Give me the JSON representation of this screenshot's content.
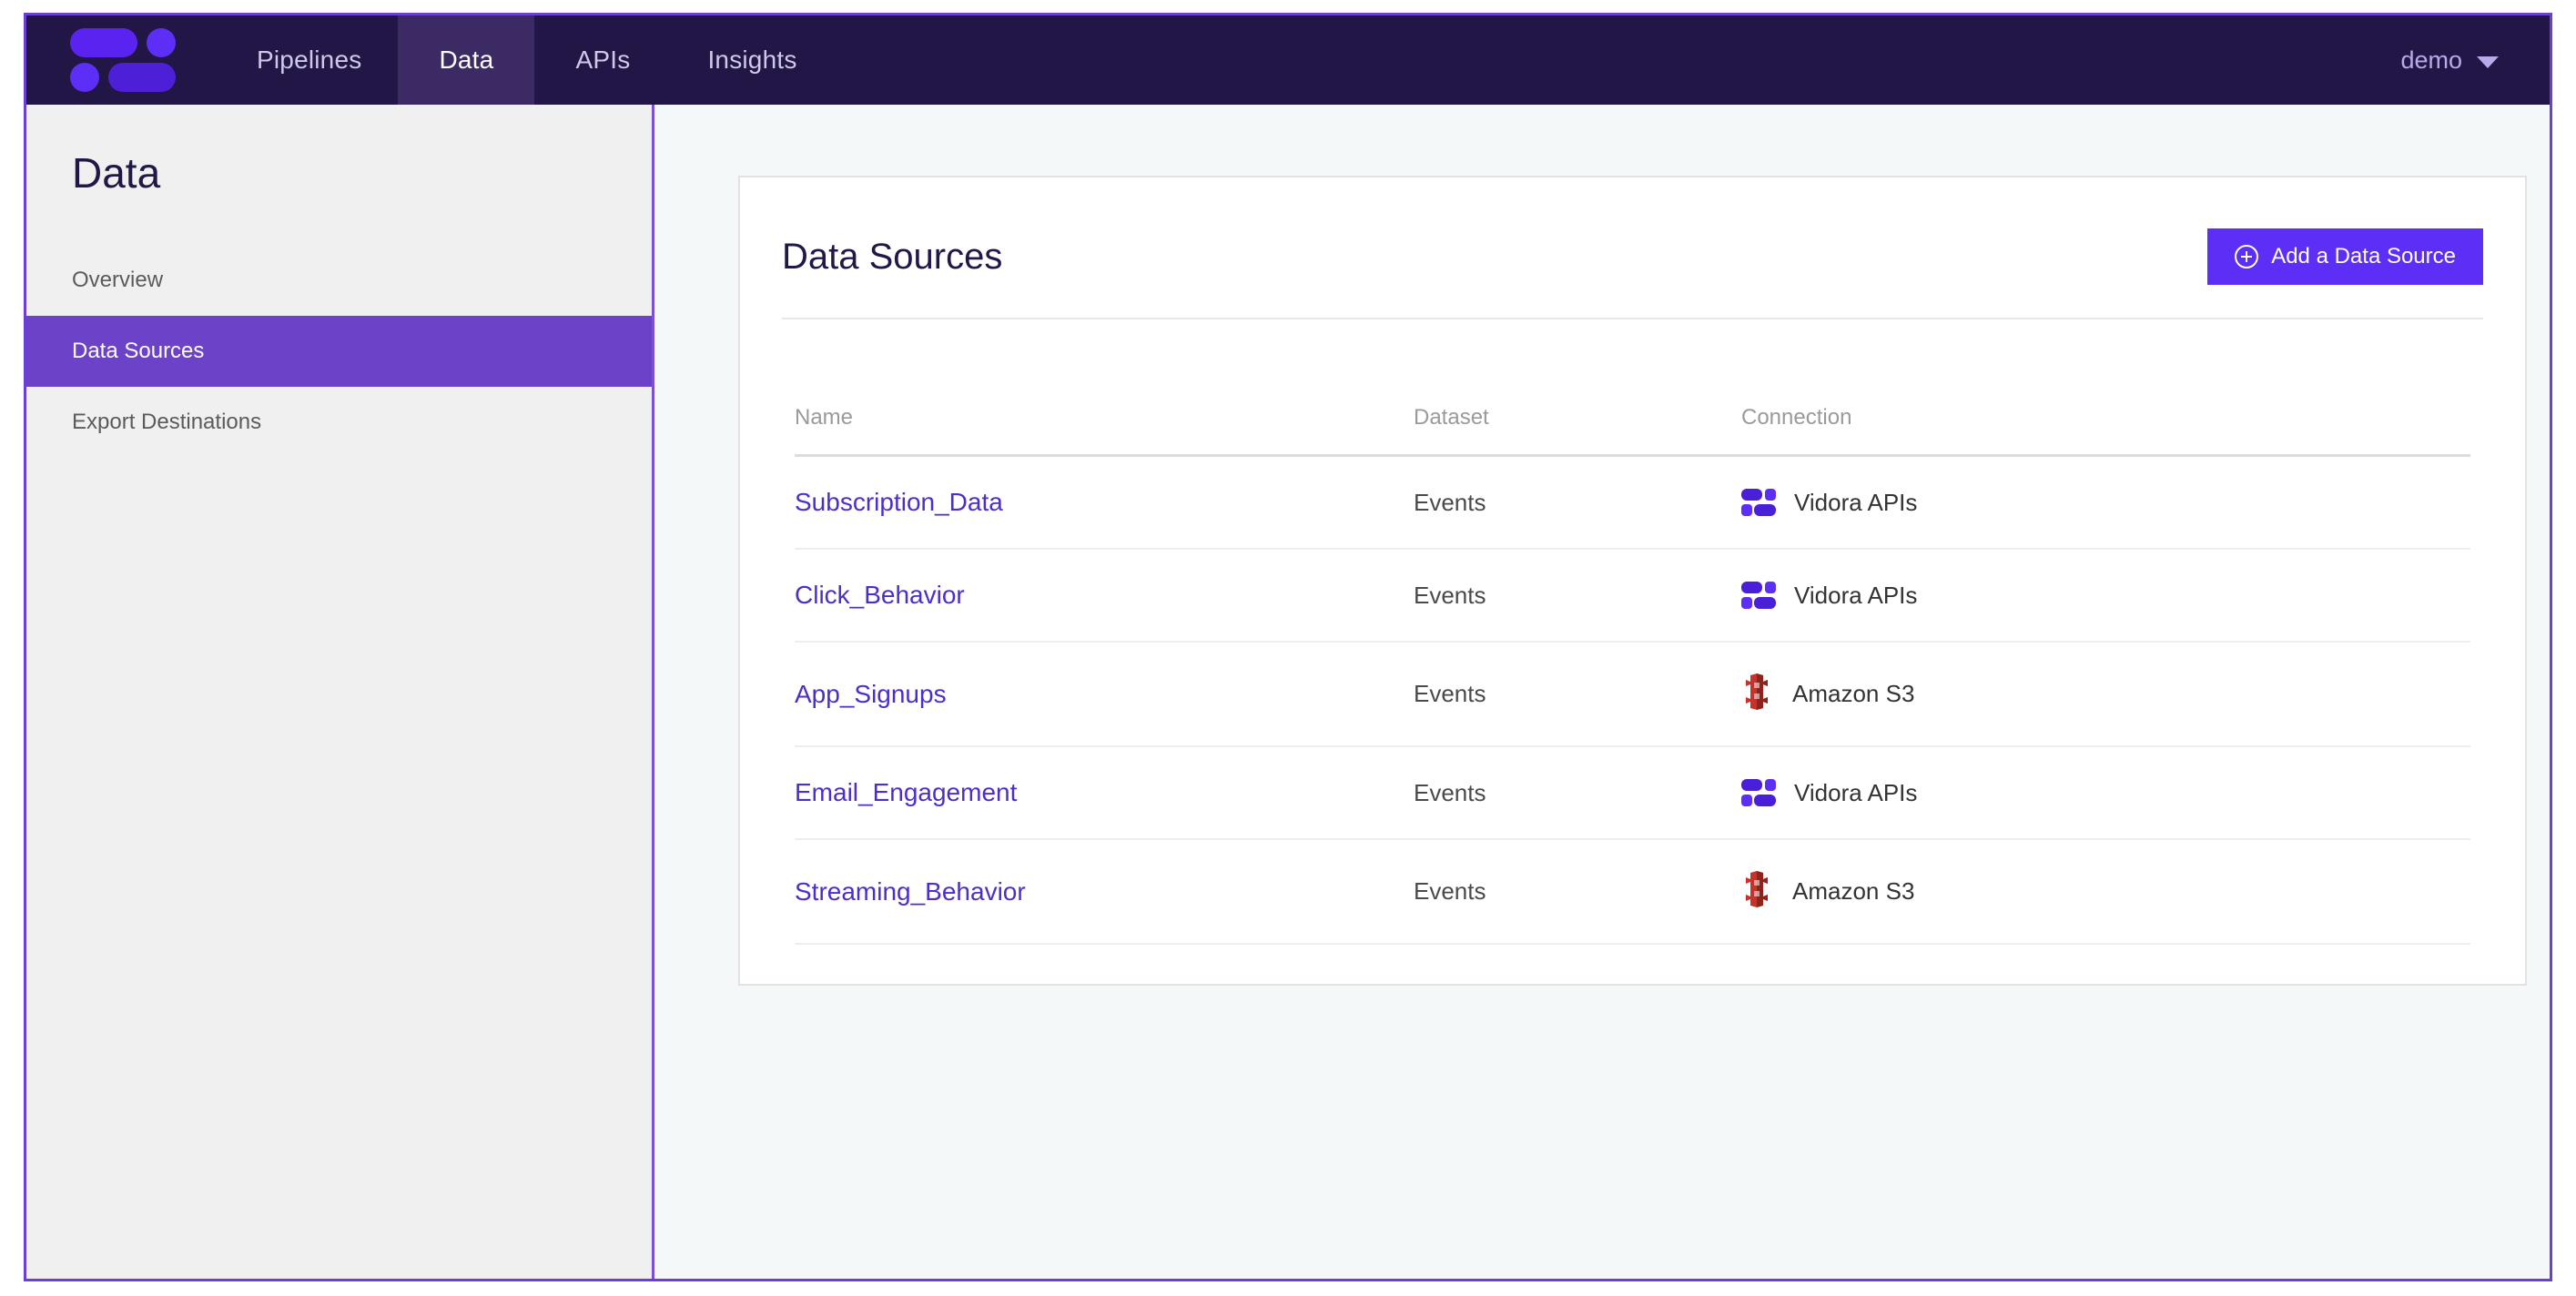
{
  "navbar": {
    "logo_name": "vidora-logo",
    "tabs": [
      {
        "label": "Pipelines",
        "active": false
      },
      {
        "label": "Data",
        "active": true
      },
      {
        "label": "APIs",
        "active": false
      },
      {
        "label": "Insights",
        "active": false
      }
    ],
    "account": {
      "label": "demo",
      "caret_icon": "chevron-down-icon"
    }
  },
  "sidebar": {
    "title": "Data",
    "items": [
      {
        "label": "Overview",
        "active": false
      },
      {
        "label": "Data Sources",
        "active": true
      },
      {
        "label": "Export Destinations",
        "active": false
      }
    ]
  },
  "card": {
    "title": "Data Sources",
    "add_button": {
      "label": "Add a Data Source",
      "icon": "plus-circle-icon"
    },
    "table": {
      "columns": [
        "Name",
        "Dataset",
        "Connection"
      ],
      "rows": [
        {
          "name": "Subscription_Data",
          "dataset": "Events",
          "connection": "Vidora APIs",
          "connection_icon": "vidora-icon"
        },
        {
          "name": "Click_Behavior",
          "dataset": "Events",
          "connection": "Vidora APIs",
          "connection_icon": "vidora-icon"
        },
        {
          "name": "App_Signups",
          "dataset": "Events",
          "connection": "Amazon S3",
          "connection_icon": "amazon-s3-icon"
        },
        {
          "name": "Email_Engagement",
          "dataset": "Events",
          "connection": "Vidora APIs",
          "connection_icon": "vidora-icon"
        },
        {
          "name": "Streaming_Behavior",
          "dataset": "Events",
          "connection": "Amazon S3",
          "connection_icon": "amazon-s3-icon"
        }
      ]
    }
  },
  "colors": {
    "navbar_bg": "#211645",
    "navbar_active_tab_bg": "#3b2a64",
    "brand_purple": "#5d2ef5",
    "sidebar_bg": "#eff0ef",
    "sidebar_active_bg": "#6b42c8",
    "canvas_bg": "#f4f8f8",
    "card_bg": "#ffffff",
    "link_purple": "#4c2ecb",
    "s3_red": "#c8322a",
    "app_border": "#6b3fd4"
  }
}
